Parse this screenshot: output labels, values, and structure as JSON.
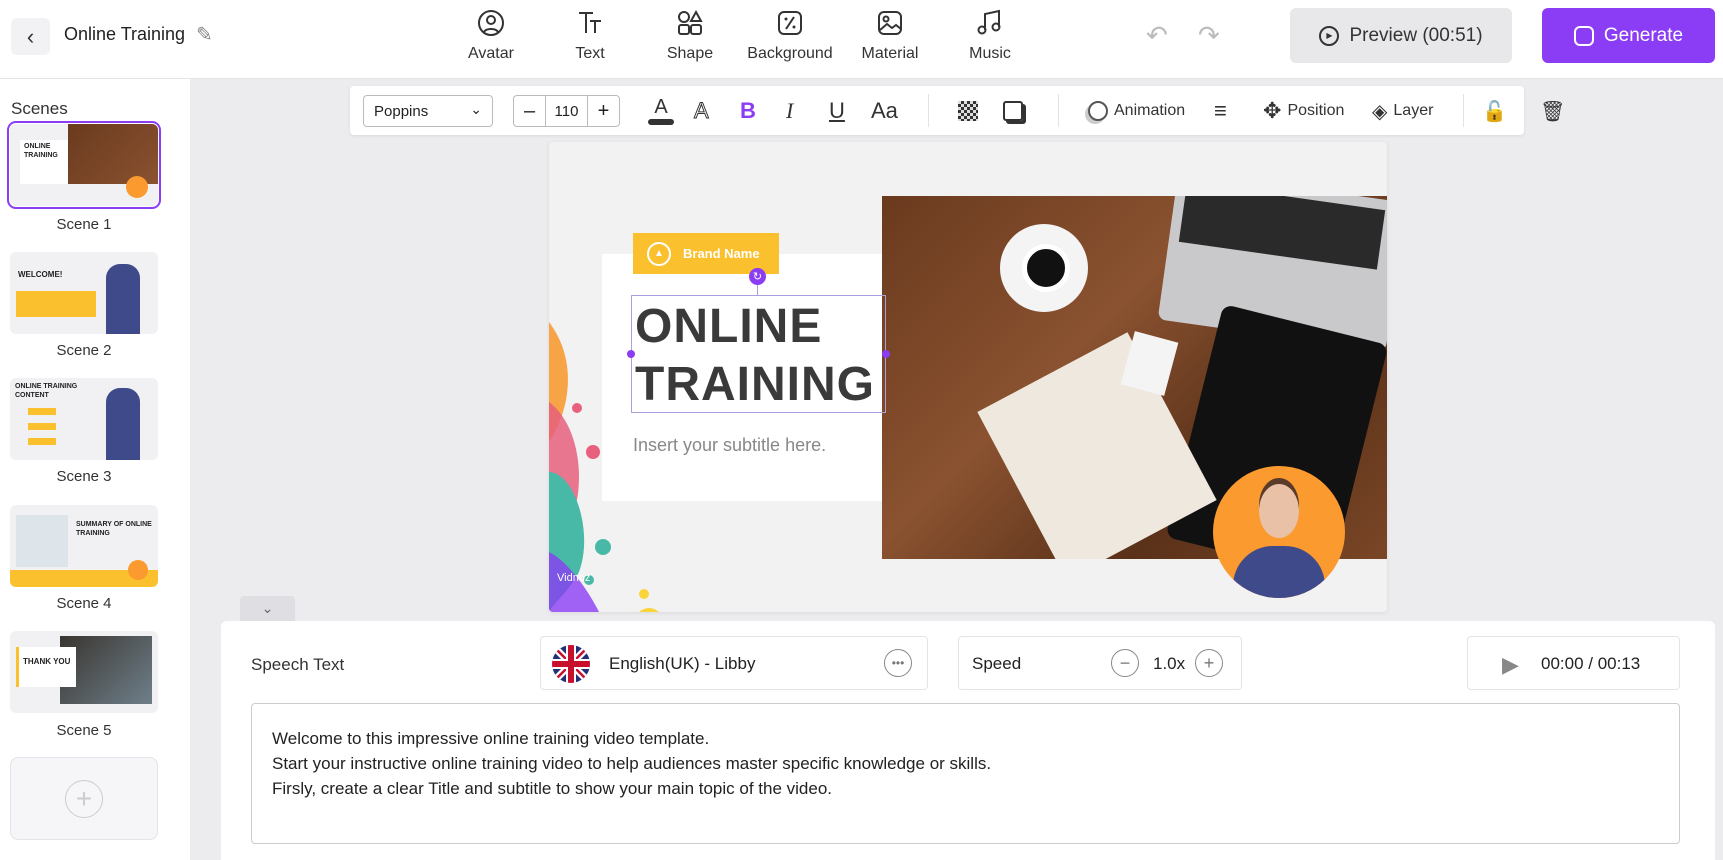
{
  "header": {
    "project_title": "Online Training",
    "tools": [
      {
        "label": "Avatar",
        "icon": "avatar-icon"
      },
      {
        "label": "Text",
        "icon": "text-icon"
      },
      {
        "label": "Shape",
        "icon": "shape-icon"
      },
      {
        "label": "Background",
        "icon": "background-icon"
      },
      {
        "label": "Material",
        "icon": "material-icon"
      },
      {
        "label": "Music",
        "icon": "music-icon"
      }
    ],
    "preview_label": "Preview (00:51)",
    "generate_label": "Generate"
  },
  "sidebar": {
    "title": "Scenes",
    "scenes": [
      {
        "label": "Scene 1",
        "heading": "ONLINE TRAINING"
      },
      {
        "label": "Scene 2",
        "heading": "WELCOME!"
      },
      {
        "label": "Scene 3",
        "heading": "ONLINE TRAINING CONTENT"
      },
      {
        "label": "Scene 4",
        "heading": "SUMMARY OF ONLINE TRAINING"
      },
      {
        "label": "Scene 5",
        "heading": "THANK YOU"
      }
    ]
  },
  "format_toolbar": {
    "font": "Poppins",
    "font_size": "110",
    "animation_label": "Animation",
    "position_label": "Position",
    "layer_label": "Layer"
  },
  "slide": {
    "brand": "Brand Name",
    "title_line1": "ONLINE",
    "title_line2": "TRAINING",
    "subtitle": "Insert your subtitle here.",
    "watermark": "Vidnoz"
  },
  "speech": {
    "label": "Speech Text",
    "voice": "English(UK) - Libby",
    "speed_label": "Speed",
    "speed_value": "1.0x",
    "time": "00:00 / 00:13",
    "lines": [
      "Welcome to this impressive online training video template.",
      "Start your instructive online training video to help audiences master specific knowledge or skills.",
      "Firsly, create a clear Title and subtitle to show your main topic of the video."
    ]
  },
  "colors": {
    "accent": "#8b3cf5",
    "yellow": "#fbc02d",
    "avatar_bg": "#fb9a2e"
  }
}
